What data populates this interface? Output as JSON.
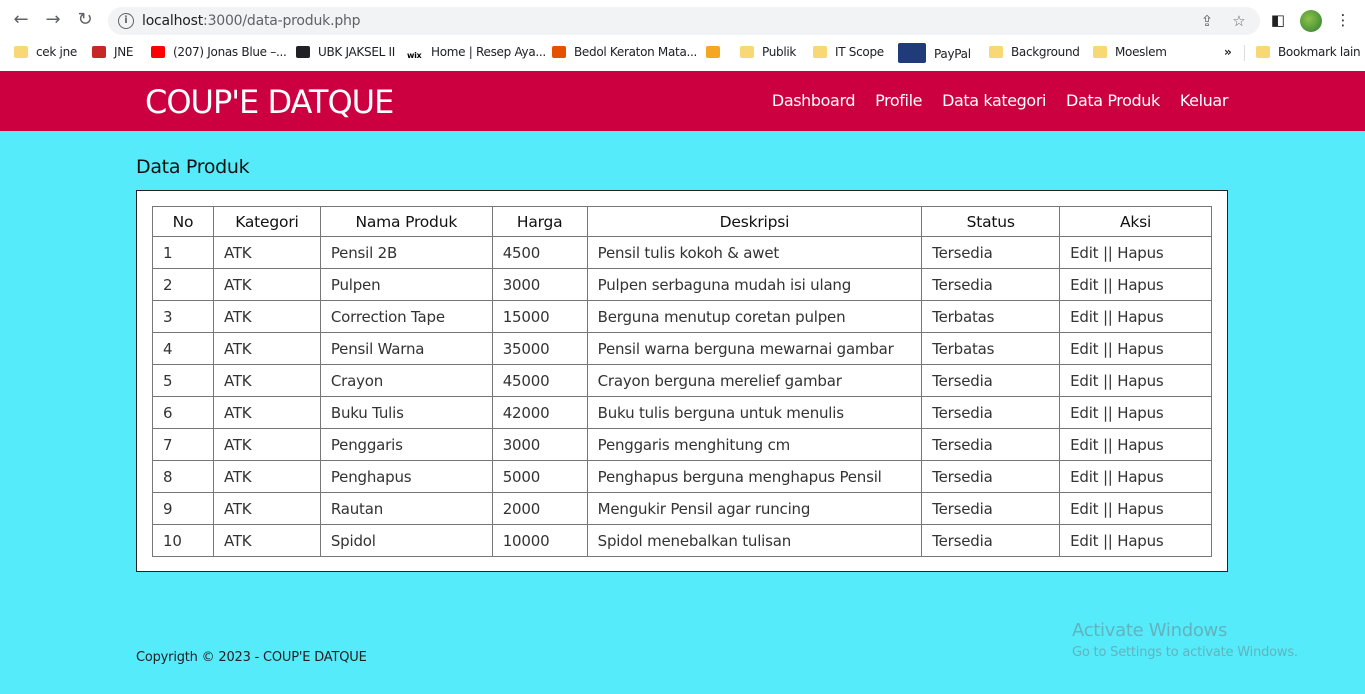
{
  "browser": {
    "url_host": "localhost",
    "url_path": ":3000/data-produk.php",
    "bookmarks": [
      {
        "label": "cek jne",
        "icon": "folder-icon"
      },
      {
        "label": "JNE",
        "icon": "jne-icon"
      },
      {
        "label": "(207) Jonas Blue –...",
        "icon": "youtube-icon"
      },
      {
        "label": "UBK JAKSEL II",
        "icon": "globe-icon"
      },
      {
        "label": "Home | Resep Aya...",
        "icon": "wix-icon"
      },
      {
        "label": "Bedol Keraton Mata...",
        "icon": "bedol-icon"
      },
      {
        "label": "",
        "icon": "p-icon"
      },
      {
        "label": "Publik",
        "icon": "folder-icon"
      },
      {
        "label": "IT Scope",
        "icon": "folder-icon"
      },
      {
        "label": "PayPal",
        "icon": "paypal-icon"
      },
      {
        "label": "Background",
        "icon": "folder-icon"
      },
      {
        "label": "Moeslem",
        "icon": "folder-icon"
      }
    ],
    "overflow": "»",
    "other_bookmarks": "Bookmark lain"
  },
  "app": {
    "brand": "COUP'E DATQUE",
    "nav": [
      "Dashboard",
      "Profile",
      "Data kategori",
      "Data Produk",
      "Keluar"
    ]
  },
  "page": {
    "title": "Data Produk",
    "columns": [
      "No",
      "Kategori",
      "Nama Produk",
      "Harga",
      "Deskripsi",
      "Status",
      "Aksi"
    ],
    "rows": [
      {
        "no": "1",
        "kategori": "ATK",
        "nama": "Pensil 2B",
        "harga": "4500",
        "deskripsi": "Pensil tulis kokoh & awet",
        "status": "Tersedia"
      },
      {
        "no": "2",
        "kategori": "ATK",
        "nama": "Pulpen",
        "harga": "3000",
        "deskripsi": "Pulpen serbaguna mudah isi ulang",
        "status": "Tersedia"
      },
      {
        "no": "3",
        "kategori": "ATK",
        "nama": "Correction Tape",
        "harga": "15000",
        "deskripsi": "Berguna menutup coretan pulpen",
        "status": "Terbatas"
      },
      {
        "no": "4",
        "kategori": "ATK",
        "nama": "Pensil Warna",
        "harga": "35000",
        "deskripsi": "Pensil warna berguna mewarnai gambar",
        "status": "Terbatas"
      },
      {
        "no": "5",
        "kategori": "ATK",
        "nama": "Crayon",
        "harga": "45000",
        "deskripsi": "Crayon berguna merelief gambar",
        "status": "Tersedia"
      },
      {
        "no": "6",
        "kategori": "ATK",
        "nama": "Buku Tulis",
        "harga": "42000",
        "deskripsi": "Buku tulis berguna untuk menulis",
        "status": "Tersedia"
      },
      {
        "no": "7",
        "kategori": "ATK",
        "nama": "Penggaris",
        "harga": "3000",
        "deskripsi": "Penggaris menghitung cm",
        "status": "Tersedia"
      },
      {
        "no": "8",
        "kategori": "ATK",
        "nama": "Penghapus",
        "harga": "5000",
        "deskripsi": "Penghapus berguna menghapus Pensil",
        "status": "Tersedia"
      },
      {
        "no": "9",
        "kategori": "ATK",
        "nama": "Rautan",
        "harga": "2000",
        "deskripsi": "Mengukir Pensil agar runcing",
        "status": "Tersedia"
      },
      {
        "no": "10",
        "kategori": "ATK",
        "nama": "Spidol",
        "harga": "10000",
        "deskripsi": "Spidol menebalkan tulisan",
        "status": "Tersedia"
      }
    ],
    "action_edit": "Edit",
    "action_sep": "||",
    "action_delete": "Hapus"
  },
  "footer": {
    "text": "Copyrigth © 2023 - COUP'E DATQUE"
  },
  "watermark": {
    "title": "Activate Windows",
    "subtitle": "Go to Settings to activate Windows."
  },
  "colors": {
    "header": "#cc0040",
    "background": "#56ebfb"
  }
}
